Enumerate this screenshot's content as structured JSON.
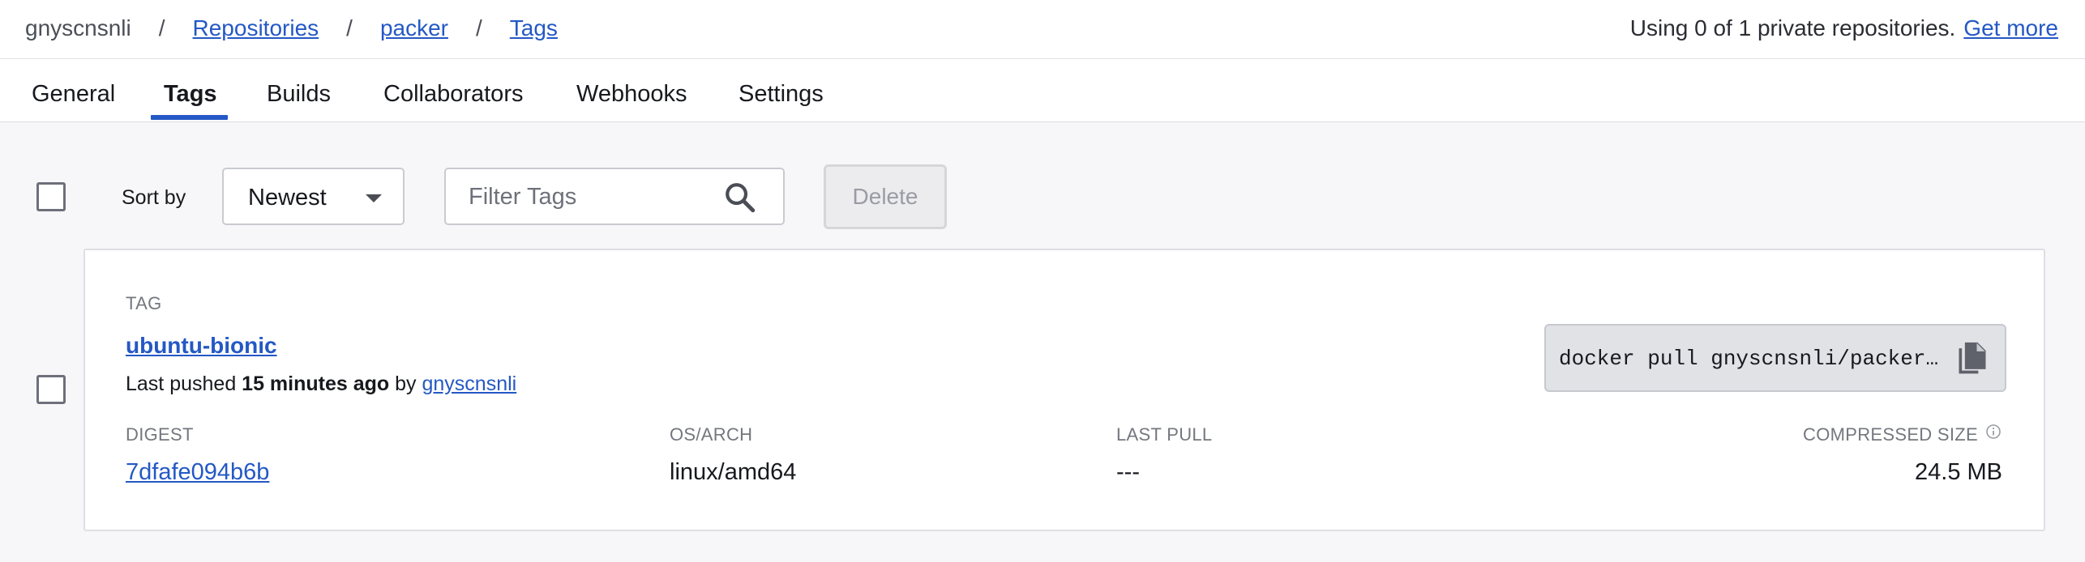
{
  "breadcrumb": {
    "user": "gnyscnsnli",
    "sep": "/",
    "repositories": "Repositories",
    "repo": "packer",
    "current": "Tags"
  },
  "usage": {
    "text": "Using 0 of 1 private repositories.",
    "link": "Get more"
  },
  "tabs": [
    {
      "label": "General",
      "active": false
    },
    {
      "label": "Tags",
      "active": true
    },
    {
      "label": "Builds",
      "active": false
    },
    {
      "label": "Collaborators",
      "active": false
    },
    {
      "label": "Webhooks",
      "active": false
    },
    {
      "label": "Settings",
      "active": false
    }
  ],
  "toolbar": {
    "sort_label": "Sort by",
    "sort_value": "Newest",
    "filter_placeholder": "Filter Tags",
    "delete_label": "Delete"
  },
  "tag_card": {
    "section_label": "TAG",
    "tag_name": "ubuntu-bionic",
    "pushed_prefix": "Last pushed",
    "pushed_time": "15 minutes ago",
    "pushed_by": "by",
    "pushed_user": "gnyscnsnli",
    "pull_command": "docker pull gnyscnsnli/packer:ubuntu-bionic",
    "digest_label": "DIGEST",
    "digest_value": "7dfafe094b6b",
    "osarch_label": "OS/ARCH",
    "osarch_value": "linux/amd64",
    "lastpull_label": "LAST PULL",
    "lastpull_value": "---",
    "size_label": "COMPRESSED SIZE",
    "size_value": "24.5 MB"
  },
  "colors": {
    "accent": "#2458c5",
    "background": "#f7f7f9",
    "card": "#ffffff"
  },
  "icons": [
    "search-icon",
    "copy-icon",
    "info-icon",
    "chevron-down-icon"
  ]
}
